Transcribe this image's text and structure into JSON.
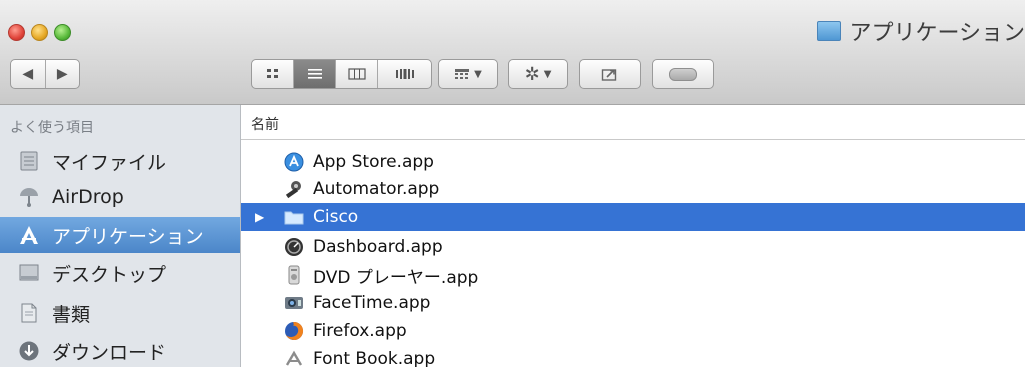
{
  "window": {
    "title": "アプリケーション",
    "title_icon": "folder-icon"
  },
  "toolbar": {
    "nav": {
      "back_icon": "back-arrow-icon",
      "forward_icon": "forward-arrow-icon"
    },
    "view_modes": [
      {
        "name": "icon-view",
        "icon": "grid-icon",
        "active": false
      },
      {
        "name": "list-view",
        "icon": "list-icon",
        "active": true
      },
      {
        "name": "column-view",
        "icon": "columns-icon",
        "active": false
      },
      {
        "name": "coverflow-view",
        "icon": "coverflow-icon",
        "active": false
      }
    ],
    "arrange_icon": "arrange-icon",
    "action_icon": "gear-icon",
    "share_icon": "share-icon",
    "tags_icon": "tag-icon"
  },
  "sidebar": {
    "header": "よく使う項目",
    "items": [
      {
        "label": "マイファイル",
        "icon": "all-my-files-icon",
        "selected": false
      },
      {
        "label": "AirDrop",
        "icon": "airdrop-icon",
        "selected": false
      },
      {
        "label": "アプリケーション",
        "icon": "applications-icon",
        "selected": true
      },
      {
        "label": "デスクトップ",
        "icon": "desktop-icon",
        "selected": false
      },
      {
        "label": "書類",
        "icon": "documents-icon",
        "selected": false
      },
      {
        "label": "ダウンロード",
        "icon": "downloads-icon",
        "selected": false
      }
    ]
  },
  "list": {
    "column_header": "名前",
    "rows": [
      {
        "name": "App Store.app",
        "icon": "app-store-icon",
        "selected": false,
        "folder": false
      },
      {
        "name": "Automator.app",
        "icon": "automator-icon",
        "selected": false,
        "folder": false
      },
      {
        "name": "Cisco",
        "icon": "folder-icon",
        "selected": true,
        "folder": true
      },
      {
        "name": "Dashboard.app",
        "icon": "dashboard-icon",
        "selected": false,
        "folder": false
      },
      {
        "name": "DVD プレーヤー.app",
        "icon": "dvd-player-icon",
        "selected": false,
        "folder": false
      },
      {
        "name": "FaceTime.app",
        "icon": "facetime-icon",
        "selected": false,
        "folder": false
      },
      {
        "name": "Firefox.app",
        "icon": "firefox-icon",
        "selected": false,
        "folder": false
      },
      {
        "name": "Font Book.app",
        "icon": "font-book-icon",
        "selected": false,
        "folder": false
      }
    ]
  },
  "colors": {
    "selection_blue": "#3673d4",
    "sidebar_bg": "#e1e5ea",
    "sidebar_selected": "#4b86c9"
  }
}
